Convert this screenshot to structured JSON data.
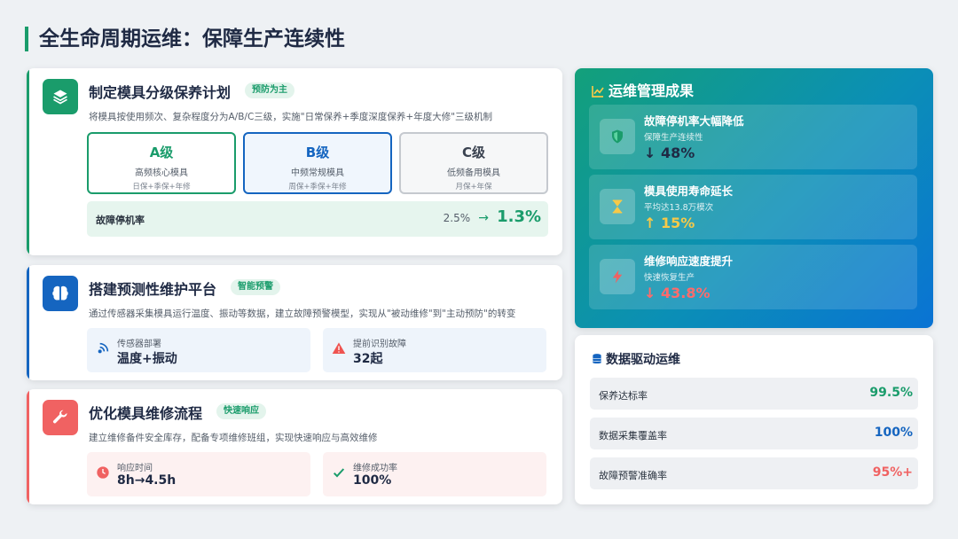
{
  "page": {
    "title": "全生命周期运维：保障生产连续性"
  },
  "colors": {
    "green": "#1a9c6b",
    "blue": "#1565c0",
    "red": "#f06262",
    "gold": "#f7c948"
  },
  "plan": {
    "icon": "layers-icon",
    "title": "制定模具分级保养计划",
    "tag": "预防为主",
    "desc": "将模具按使用频次、复杂程度分为A/B/C三级，实施\"日常保养+季度深度保养+年度大修\"三级机制",
    "levels": [
      {
        "name": "A级",
        "sub": "高频核心模具",
        "cycle": "日保+季保+年修"
      },
      {
        "name": "B级",
        "sub": "中频常规模具",
        "cycle": "周保+季保+年修"
      },
      {
        "name": "C级",
        "sub": "低频备用模具",
        "cycle": "月保+年保"
      }
    ],
    "rate": {
      "label": "故障停机率",
      "old": "2.5%",
      "arrow": "→",
      "new": "1.3%"
    }
  },
  "platform": {
    "icon": "brain-icon",
    "title": "搭建预测性维护平台",
    "tag": "智能预警",
    "desc": "通过传感器采集模具运行温度、振动等数据，建立故障预警模型，实现从\"被动维修\"到\"主动预防\"的转变",
    "stats": [
      {
        "icon": "sensor-icon",
        "label": "传感器部署",
        "value": "温度+振动"
      },
      {
        "icon": "warning-icon",
        "label": "提前识别故障",
        "value": "32起"
      }
    ]
  },
  "repair": {
    "icon": "wrench-icon",
    "title": "优化模具维修流程",
    "tag": "快速响应",
    "desc": "建立维修备件安全库存，配备专项维修班组，实现快速响应与高效维修",
    "stats": [
      {
        "icon": "clock-icon",
        "label": "响应时间",
        "value": "8h→4.5h"
      },
      {
        "icon": "check-icon",
        "label": "维修成功率",
        "value": "100%"
      }
    ]
  },
  "results": {
    "icon": "chart-line-icon",
    "title": "运维管理成果",
    "items": [
      {
        "icon": "shield-icon",
        "title": "故障停机率大幅降低",
        "sub": "保障生产连续性",
        "value": "↓ 48%"
      },
      {
        "icon": "hourglass-icon",
        "title": "模具使用寿命延长",
        "sub": "平均达13.8万模次",
        "value": "↑ 15%"
      },
      {
        "icon": "bolt-icon",
        "title": "维修响应速度提升",
        "sub": "快速恢复生产",
        "value": "↓ 43.8%"
      }
    ]
  },
  "data_ops": {
    "icon": "database-icon",
    "title": "数据驱动运维",
    "rows": [
      {
        "label": "保养达标率",
        "value": "99.5%"
      },
      {
        "label": "数据采集覆盖率",
        "value": "100%"
      },
      {
        "label": "故障预警准确率",
        "value": "95%+"
      }
    ]
  }
}
